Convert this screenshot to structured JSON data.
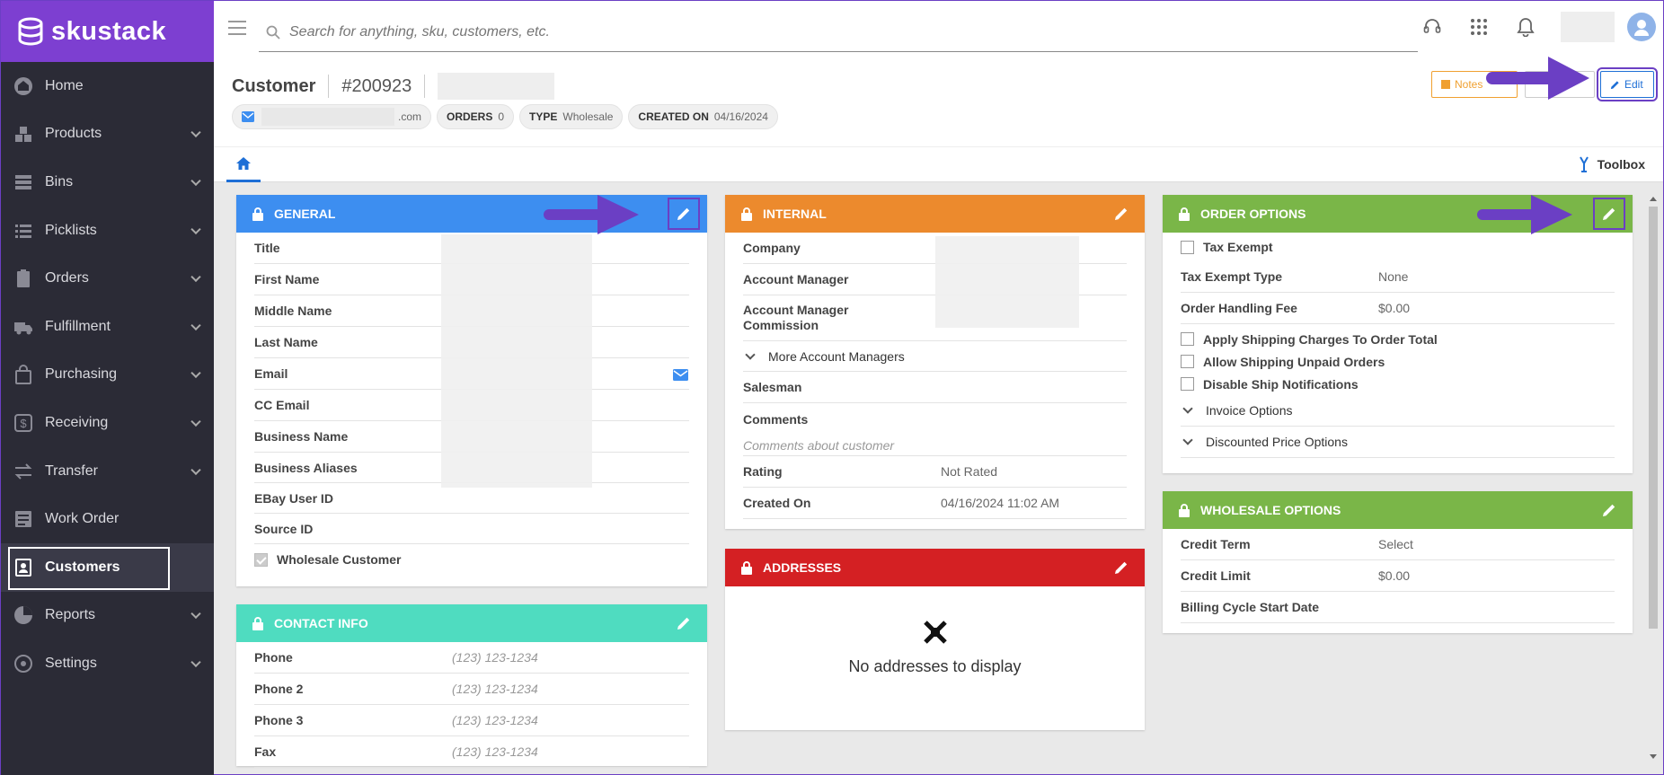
{
  "app": {
    "brand": "skustack"
  },
  "sidebar": {
    "items": [
      {
        "label": "Home",
        "icon": "home-icon",
        "chevron": false
      },
      {
        "label": "Products",
        "icon": "boxes-icon",
        "chevron": true
      },
      {
        "label": "Bins",
        "icon": "bins-icon",
        "chevron": true
      },
      {
        "label": "Picklists",
        "icon": "list-icon",
        "chevron": true
      },
      {
        "label": "Orders",
        "icon": "clipboard-icon",
        "chevron": true
      },
      {
        "label": "Fulfillment",
        "icon": "truck-icon",
        "chevron": true
      },
      {
        "label": "Purchasing",
        "icon": "bag-icon",
        "chevron": true
      },
      {
        "label": "Receiving",
        "icon": "dollar-icon",
        "chevron": true
      },
      {
        "label": "Transfer",
        "icon": "transfer-icon",
        "chevron": true
      },
      {
        "label": "Work Order",
        "icon": "workorder-icon",
        "chevron": false
      },
      {
        "label": "Customers",
        "icon": "customers-icon",
        "chevron": false,
        "active": true
      },
      {
        "label": "Reports",
        "icon": "reports-icon",
        "chevron": true
      },
      {
        "label": "Settings",
        "icon": "gear-icon",
        "chevron": true
      }
    ]
  },
  "search": {
    "placeholder": "Search for anything, sku, customers, etc."
  },
  "header": {
    "title": "Customer",
    "id": "#200923",
    "email_suffix": ".com",
    "orders_label": "ORDERS",
    "orders_value": "0",
    "type_label": "TYPE",
    "type_value": "Wholesale",
    "created_label": "CREATED ON",
    "created_value": "04/16/2024",
    "notes_label": "Notes",
    "edit_label": "Edit",
    "toolbox_label": "Toolbox"
  },
  "general": {
    "title": "GENERAL",
    "rows": [
      "Title",
      "First Name",
      "Middle Name",
      "Last Name",
      "Email",
      "CC Email",
      "Business Name",
      "Business Aliases",
      "EBay User ID",
      "Source ID"
    ],
    "wholesale_label": "Wholesale Customer"
  },
  "contact": {
    "title": "CONTACT INFO",
    "rows": [
      {
        "label": "Phone",
        "placeholder": "(123) 123-1234"
      },
      {
        "label": "Phone 2",
        "placeholder": "(123) 123-1234"
      },
      {
        "label": "Phone 3",
        "placeholder": "(123) 123-1234"
      },
      {
        "label": "Fax",
        "placeholder": "(123) 123-1234"
      }
    ]
  },
  "internal": {
    "title": "INTERNAL",
    "company": "Company",
    "account_manager": "Account Manager",
    "commission_1": "Account Manager",
    "commission_2": "Commission",
    "more_managers": "More Account Managers",
    "salesman": "Salesman",
    "comments": "Comments",
    "comments_placeholder": "Comments about customer",
    "rating_label": "Rating",
    "rating_value": "Not Rated",
    "created_label": "Created On",
    "created_value": "04/16/2024 11:02 AM"
  },
  "addresses": {
    "title": "ADDRESSES",
    "empty": "No addresses to display"
  },
  "order_options": {
    "title": "ORDER OPTIONS",
    "tax_exempt": "Tax Exempt",
    "tax_exempt_type_label": "Tax Exempt Type",
    "tax_exempt_type_value": "None",
    "handling_label": "Order Handling Fee",
    "handling_value": "$0.00",
    "apply_shipping": "Apply Shipping Charges To Order Total",
    "allow_unpaid": "Allow Shipping Unpaid Orders",
    "disable_notifications": "Disable Ship Notifications",
    "invoice_options": "Invoice Options",
    "discounted_options": "Discounted Price Options"
  },
  "wholesale_options": {
    "title": "WHOLESALE OPTIONS",
    "credit_term_label": "Credit Term",
    "credit_term_value": "Select",
    "credit_limit_label": "Credit Limit",
    "credit_limit_value": "$0.00",
    "billing_cycle_label": "Billing Cycle Start Date"
  },
  "colors": {
    "brand": "#7d3fd1",
    "general": "#3d8ef0",
    "internal": "#ec8a2d",
    "addresses": "#d42023",
    "order_options": "#7ab648",
    "contact": "#4fdcc0",
    "annotation": "#6b3fc4"
  }
}
